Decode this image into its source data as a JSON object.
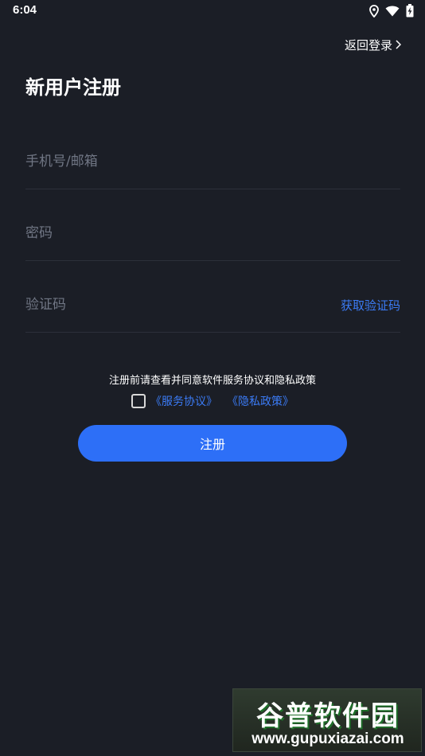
{
  "status_bar": {
    "time": "6:04",
    "icons": [
      "location-icon",
      "wifi-icon",
      "battery-charging-icon"
    ]
  },
  "header": {
    "back_login": "返回登录"
  },
  "page_title": "新用户注册",
  "form": {
    "phone_placeholder": "手机号/邮箱",
    "password_placeholder": "密码",
    "code_placeholder": "验证码",
    "get_code": "获取验证码"
  },
  "agreement": {
    "text": "注册前请查看并同意软件服务协议和隐私政策",
    "service_link": "《服务协议》",
    "privacy_link": "《隐私政策》",
    "checked": false
  },
  "register_button": "注册",
  "watermark": {
    "logo": "谷普软件园",
    "url": "www.gupuxiazai.com"
  },
  "colors": {
    "background": "#1b1e26",
    "accent": "#2d6ff7",
    "link": "#3b7bf5",
    "placeholder": "#707684",
    "divider": "#2c303a"
  }
}
